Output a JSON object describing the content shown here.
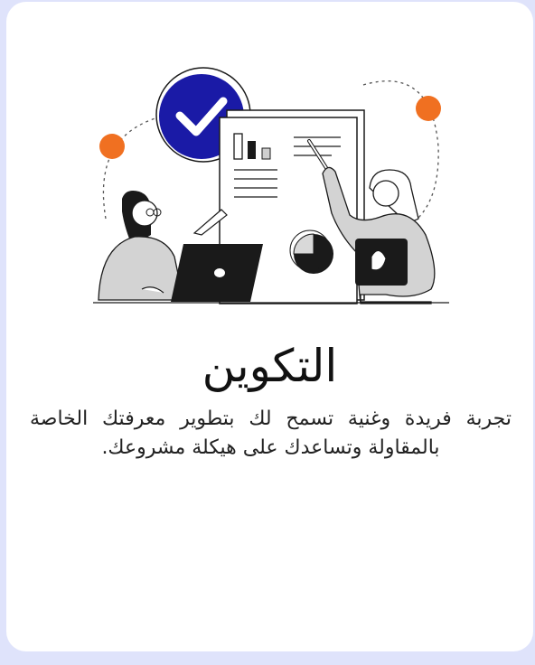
{
  "card": {
    "title": "التكوين",
    "description": "تجربة فريدة وغنية تسمح لك بتطوير معرفتك الخاصة بالمقاولة وتساعدك على هيكلة مشروعك.",
    "illustration": {
      "icon": "checkmark-badge-icon",
      "accent_color": "#f07021",
      "badge_color": "#1a1aa6",
      "ink_color": "#1a1a1a"
    }
  }
}
